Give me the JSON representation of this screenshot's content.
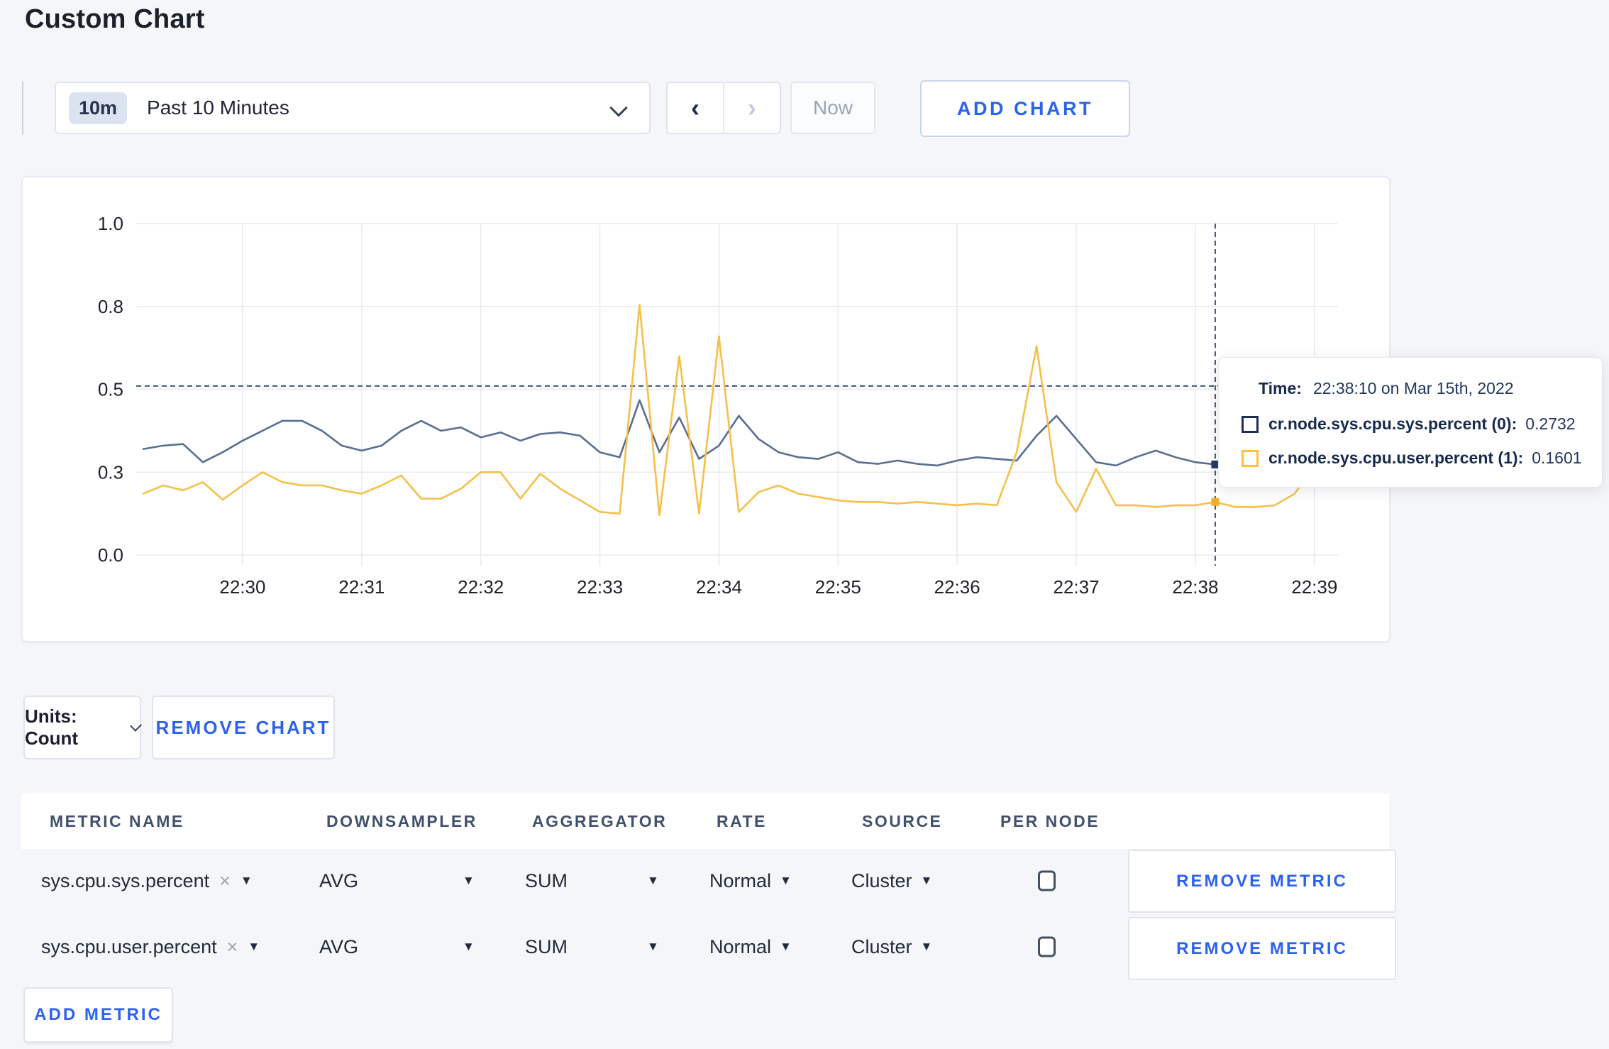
{
  "page": {
    "title": "Custom Chart",
    "bg": "#f4f6f9"
  },
  "icons": {
    "caret_down": "▼",
    "close": "×",
    "prev": "‹",
    "next": "›"
  },
  "toolbar": {
    "range_badge": "10m",
    "range_label": "Past 10 Minutes",
    "now_label": "Now",
    "add_chart_label": "ADD CHART"
  },
  "units": {
    "label": "Units: Count"
  },
  "remove_chart_label": "REMOVE CHART",
  "add_metric_label": "ADD METRIC",
  "colors": {
    "sys_series": "#5a6e92",
    "user_series": "#f5c04a",
    "accent_blue": "#2c62f0",
    "crosshair": "#3d5377",
    "tooltip_navy": "#1c2f55",
    "tooltip_yellow": "#fdc03a"
  },
  "chart_data": {
    "type": "line",
    "title": "",
    "xlabel": "",
    "ylabel": "",
    "ylim": [
      0,
      1
    ],
    "grid": true,
    "legend_position": "none",
    "x_start_time": "22:29:10",
    "x_interval_seconds": 10,
    "x_ticks": [
      "22:30",
      "22:31",
      "22:32",
      "22:33",
      "22:34",
      "22:35",
      "22:36",
      "22:37",
      "22:38",
      "22:39"
    ],
    "y_tick_labels": [
      "0.0",
      "0.3",
      "0.5",
      "0.8",
      "1.0"
    ],
    "y_tick_values": [
      0,
      0.25,
      0.5,
      0.75,
      1.0
    ],
    "series": [
      {
        "name": "cr.node.sys.cpu.sys.percent",
        "node": "(0)",
        "color": "#5a6e92",
        "values": [
          0.32,
          0.33,
          0.335,
          0.28,
          0.31,
          0.345,
          0.375,
          0.405,
          0.405,
          0.375,
          0.33,
          0.315,
          0.33,
          0.375,
          0.405,
          0.375,
          0.385,
          0.355,
          0.37,
          0.345,
          0.365,
          0.37,
          0.36,
          0.31,
          0.295,
          0.467,
          0.31,
          0.415,
          0.29,
          0.33,
          0.42,
          0.35,
          0.31,
          0.295,
          0.29,
          0.31,
          0.28,
          0.275,
          0.285,
          0.275,
          0.27,
          0.285,
          0.295,
          0.29,
          0.285,
          0.36,
          0.42,
          0.35,
          0.28,
          0.27,
          0.295,
          0.315,
          0.295,
          0.28,
          0.2732,
          0.26,
          0.25,
          0.255,
          0.3,
          0.305,
          0.285
        ]
      },
      {
        "name": "cr.node.sys.cpu.user.percent",
        "node": "(1)",
        "color": "#f5c04a",
        "values": [
          0.185,
          0.21,
          0.195,
          0.22,
          0.167,
          0.21,
          0.25,
          0.22,
          0.21,
          0.21,
          0.195,
          0.185,
          0.21,
          0.24,
          0.17,
          0.17,
          0.2,
          0.25,
          0.25,
          0.17,
          0.245,
          0.2,
          0.165,
          0.13,
          0.125,
          0.755,
          0.12,
          0.6,
          0.125,
          0.66,
          0.13,
          0.19,
          0.21,
          0.185,
          0.175,
          0.165,
          0.16,
          0.16,
          0.155,
          0.16,
          0.155,
          0.15,
          0.155,
          0.15,
          0.31,
          0.63,
          0.22,
          0.13,
          0.26,
          0.15,
          0.15,
          0.145,
          0.15,
          0.15,
          0.1601,
          0.145,
          0.145,
          0.15,
          0.185,
          0.27,
          0.225
        ]
      }
    ],
    "crosshair": {
      "index": 54,
      "hline_value": 0.51,
      "point_values": [
        0.2732,
        0.1601
      ]
    },
    "tooltip": {
      "time_label": "Time:",
      "time_value": "22:38:10 on Mar 15th, 2022",
      "rows": [
        {
          "label": "cr.node.sys.cpu.sys.percent (0):",
          "value": "0.2732",
          "color": "#1c2f55"
        },
        {
          "label": "cr.node.sys.cpu.user.percent (1):",
          "value": "0.1601",
          "color": "#fdc03a"
        }
      ]
    }
  },
  "table": {
    "headers": [
      "METRIC NAME",
      "DOWNSAMPLER",
      "AGGREGATOR",
      "RATE",
      "SOURCE",
      "PER NODE"
    ],
    "rows": [
      {
        "metric": "sys.cpu.sys.percent",
        "downsampler": "AVG",
        "aggregator": "SUM",
        "rate": "Normal",
        "source": "Cluster",
        "per_node_checked": false,
        "remove_label": "REMOVE METRIC"
      },
      {
        "metric": "sys.cpu.user.percent",
        "downsampler": "AVG",
        "aggregator": "SUM",
        "rate": "Normal",
        "source": "Cluster",
        "per_node_checked": false,
        "remove_label": "REMOVE METRIC"
      }
    ]
  }
}
